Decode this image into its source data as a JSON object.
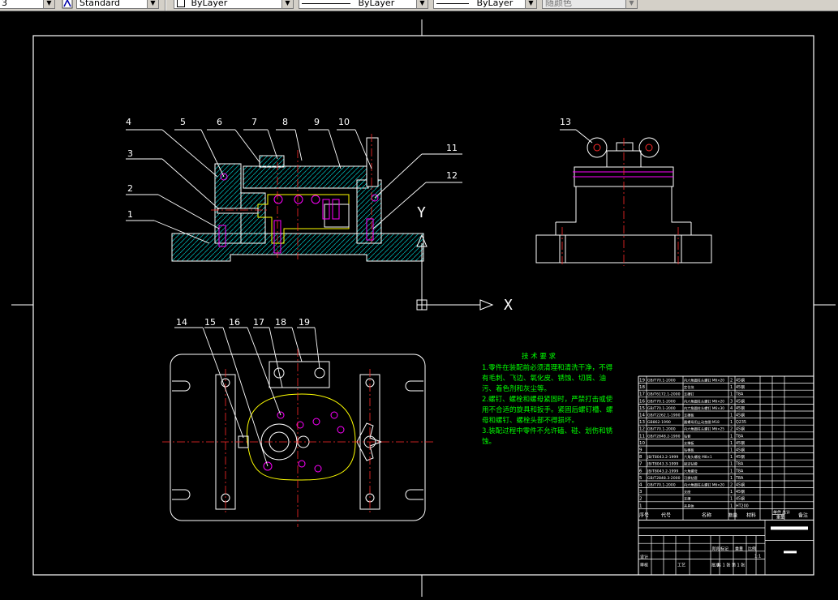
{
  "toolbar": {
    "layer_value": "3",
    "textstyle_value": "Standard",
    "color_value": "ByLayer",
    "linetype_value": "ByLayer",
    "lineweight_value": "ByLayer",
    "plotstyle_value": "随颜色"
  },
  "drawing": {
    "callouts_top": [
      "4",
      "5",
      "6",
      "7",
      "8",
      "9",
      "10",
      "3",
      "2",
      "1",
      "11",
      "12"
    ],
    "callout_side": "13",
    "callouts_plan": [
      "14",
      "15",
      "16",
      "17",
      "18",
      "19"
    ],
    "ucs_y": "Y",
    "ucs_x": "X"
  },
  "tech": {
    "title": "技 术 要 求",
    "lines": [
      "1.零件在装配前必须清理和清洗干净，不得",
      "有毛刺、飞边、氧化皮、锈蚀、切屑、油",
      "污、着色剂和灰尘等。",
      "2.螺钉、螺栓和螺母紧固时，严禁打击或使",
      "用不合适的旋具和扳手。紧固后螺钉槽、螺",
      "母和螺钉、螺栓头部不得损坏。",
      "3.装配过程中零件不允许磕、碰、划伤和锈",
      "蚀。"
    ]
  },
  "title_block": {
    "header": [
      "序号",
      "代号",
      "名称",
      "数量",
      "材料",
      "单件",
      "总计",
      "备注"
    ],
    "weight_label": "重量",
    "rows": [
      {
        "no": "19",
        "code": "GB/T70.1-2000",
        "name": "内六角圆柱头螺钉 M6×20",
        "qty": "2",
        "mat": "45钢"
      },
      {
        "no": "18",
        "code": "",
        "name": "定位块",
        "qty": "1",
        "mat": "45钢"
      },
      {
        "no": "17",
        "code": "GB/T6172.1-2000",
        "name": "支撑钉",
        "qty": "1",
        "mat": "T8A"
      },
      {
        "no": "16",
        "code": "GB/T70.1-2000",
        "name": "内六角圆柱头螺钉 M6×20",
        "qty": "3",
        "mat": "45钢"
      },
      {
        "no": "15",
        "code": "GB/T70.1-2000",
        "name": "内六角圆柱头螺钉 M6×30",
        "qty": "4",
        "mat": "45钢"
      },
      {
        "no": "14",
        "code": "GB/T2262.1-1990",
        "name": "支撑板",
        "qty": "1",
        "mat": "45钢"
      },
      {
        "no": "13",
        "code": "GB862-1990",
        "name": "圆螺母用止动垫圈 M18",
        "qty": "1",
        "mat": "Q235"
      },
      {
        "no": "12",
        "code": "GB/T70.1-2000",
        "name": "内六角圆柱头螺钉 M6×25",
        "qty": "2",
        "mat": "45钢"
      },
      {
        "no": "11",
        "code": "GB/T2848.2-1990",
        "name": "钻套",
        "qty": "1",
        "mat": "T8A"
      },
      {
        "no": "10",
        "code": "",
        "name": "支撑板",
        "qty": "1",
        "mat": "45钢"
      },
      {
        "no": "9",
        "code": "",
        "name": "钻模板",
        "qty": "1",
        "mat": "45钢"
      },
      {
        "no": "8",
        "code": "JB/T8043.2-1999",
        "name": "六角头螺栓 M8×1",
        "qty": "1",
        "mat": "45钢"
      },
      {
        "no": "7",
        "code": "JB/T8043.3-1999",
        "name": "固定钻套",
        "qty": "1",
        "mat": "T8A"
      },
      {
        "no": "6",
        "code": "JB/T8043.2-1999",
        "name": "六角螺母",
        "qty": "1",
        "mat": "T8A"
      },
      {
        "no": "5",
        "code": "GB/T2848.3-2000",
        "name": "可换钻套",
        "qty": "1",
        "mat": "T8A"
      },
      {
        "no": "4",
        "code": "GB/T70.1-2000",
        "name": "内六角圆柱头螺钉 M6×20",
        "qty": "2",
        "mat": "45钢"
      },
      {
        "no": "3",
        "code": "",
        "name": "支座",
        "qty": "1",
        "mat": "45钢"
      },
      {
        "no": "2",
        "code": "",
        "name": "支撑",
        "qty": "1",
        "mat": "45钢"
      },
      {
        "no": "1",
        "code": "",
        "name": "夹具体",
        "qty": "1",
        "mat": "HT200"
      }
    ],
    "labels": {
      "design": "设计",
      "review": "审核",
      "process": "工艺",
      "approve": "批准",
      "stage": "阶段标记",
      "weight": "重量",
      "scale": "比例",
      "scale_value": "1:1",
      "sheet": "共 1 张 第 1 张"
    }
  }
}
